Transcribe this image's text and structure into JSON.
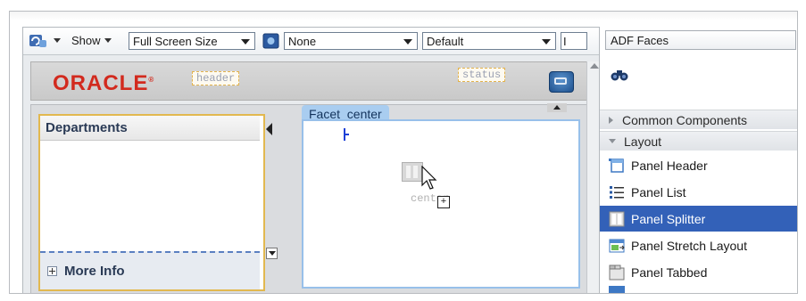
{
  "toolbar": {
    "show_label": "Show",
    "screen_size": "Full Screen Size",
    "skin": "None",
    "style": "Default",
    "truncated": "I"
  },
  "canvas": {
    "brand": "ORACLE",
    "header_facet": "header",
    "status_facet": "status",
    "facet_tab": "Facet",
    "facet_name": "center",
    "drop_label": "center",
    "left_pane_title": "Departments",
    "more_info": "More Info"
  },
  "palette": {
    "library": "ADF Faces",
    "sections": [
      {
        "label": "Common Components",
        "expanded": false
      },
      {
        "label": "Layout",
        "expanded": true
      }
    ],
    "items": [
      {
        "label": "Panel Header",
        "icon": "panel-header-icon",
        "selected": false
      },
      {
        "label": "Panel List",
        "icon": "panel-list-icon",
        "selected": false
      },
      {
        "label": "Panel Splitter",
        "icon": "panel-splitter-icon",
        "selected": true
      },
      {
        "label": "Panel Stretch Layout",
        "icon": "panel-stretch-icon",
        "selected": false
      },
      {
        "label": "Panel Tabbed",
        "icon": "panel-tabbed-icon",
        "selected": false
      }
    ]
  },
  "colors": {
    "brand_red": "#d22a1e",
    "selection_blue": "#3361b8",
    "facet_tab_blue": "#a9cdf0"
  }
}
